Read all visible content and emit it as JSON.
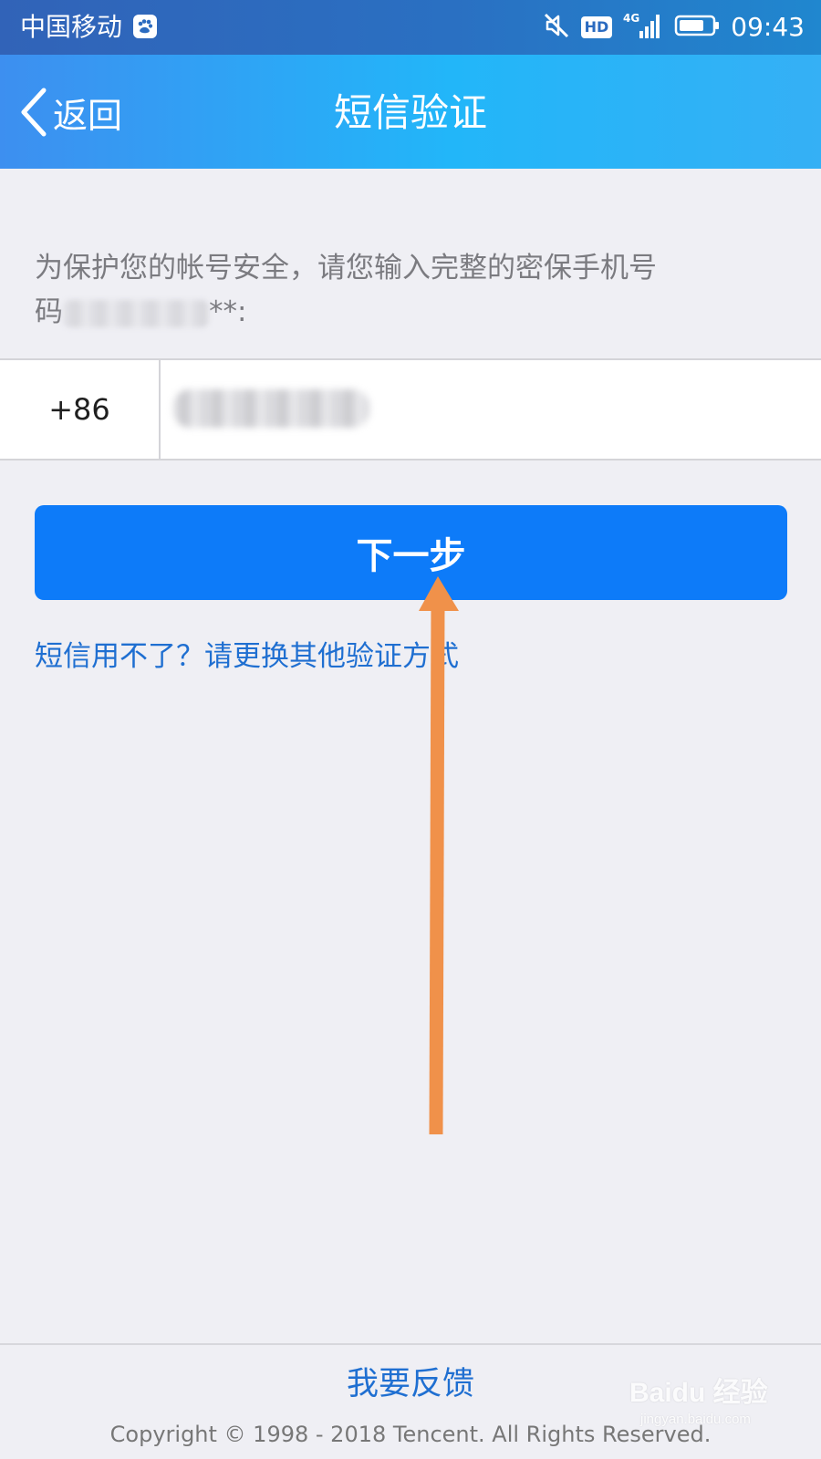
{
  "status_bar": {
    "carrier": "中国移动",
    "network": "4G",
    "hd": "HD",
    "time": "09:43"
  },
  "nav": {
    "back_label": "返回",
    "title": "短信验证"
  },
  "form": {
    "hint_line1": "为保护您的帐号安全，请您输入完整的密保手机号",
    "hint_line2": "码",
    "hint_suffix": "**:",
    "country_code": "+86",
    "phone_value": "",
    "next_label": "下一步",
    "alt_link": "短信用不了？请更换其他验证方式"
  },
  "footer": {
    "feedback": "我要反馈",
    "copyright": "Copyright © 1998 - 2018 Tencent. All Rights Reserved."
  },
  "watermark": {
    "brand": "Baidu 经验",
    "url": "jingyan.baidu.com"
  },
  "colors": {
    "accent": "#0d7bf9",
    "link": "#1f6fd1",
    "annotation_arrow": "#f0914a",
    "background": "#efeff4"
  },
  "icons": {
    "back": "chevron-left-icon",
    "mute": "mute-icon",
    "signal": "signal-icon",
    "battery": "battery-icon",
    "baidu": "baidu-paw-icon"
  }
}
